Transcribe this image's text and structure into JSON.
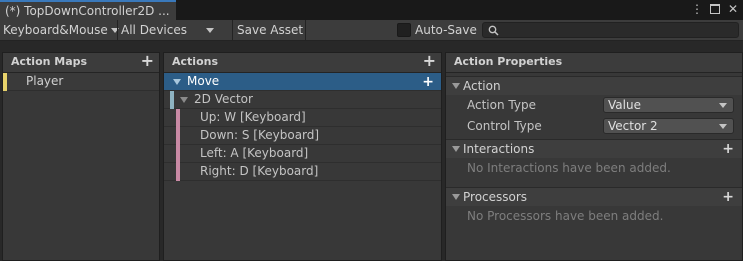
{
  "window": {
    "tab_title": "(*) TopDownController2D ...",
    "icons": [
      "more-vert-icon",
      "maximize-icon",
      "close-icon"
    ]
  },
  "toolbar": {
    "control_scheme": "Keyboard&Mouse",
    "devices": "All Devices",
    "save_asset": "Save Asset",
    "auto_save_label": "Auto-Save",
    "auto_save_checked": false,
    "search_value": ""
  },
  "action_maps": {
    "header": "Action Maps",
    "items": [
      {
        "label": "Player",
        "marker_color": "#e7d26b"
      }
    ]
  },
  "actions": {
    "header": "Actions",
    "action": {
      "label": "Move",
      "selected": true
    },
    "composite": {
      "label": "2D Vector",
      "marker_color": "#8eb3c1"
    },
    "bindings": [
      {
        "label": "Up: W [Keyboard]",
        "marker_color": "#c98aa5"
      },
      {
        "label": "Down: S [Keyboard]",
        "marker_color": "#c98aa5"
      },
      {
        "label": "Left: A [Keyboard]",
        "marker_color": "#c98aa5"
      },
      {
        "label": "Right: D [Keyboard]",
        "marker_color": "#c98aa5"
      }
    ]
  },
  "properties": {
    "header": "Action Properties",
    "action_section": "Action",
    "action_type_label": "Action Type",
    "action_type_value": "Value",
    "control_type_label": "Control Type",
    "control_type_value": "Vector 2",
    "interactions_section": "Interactions",
    "interactions_empty": "No Interactions have been added.",
    "processors_section": "Processors",
    "processors_empty": "No Processors have been added."
  },
  "colors": {
    "selection": "#2c5d87",
    "tab_accent": "#3a79bb"
  }
}
